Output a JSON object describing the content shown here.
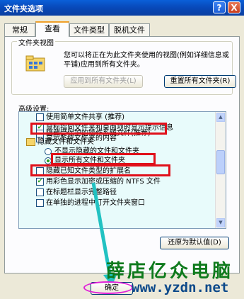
{
  "window": {
    "title": "文件夹选项",
    "help_label": "?",
    "close_label": "X"
  },
  "tabs": [
    {
      "label": "常规"
    },
    {
      "label": "查看"
    },
    {
      "label": "文件类型"
    },
    {
      "label": "脱机文件"
    }
  ],
  "folder_views": {
    "legend": "文件夹视图",
    "description": "您可以将正在为此文件夹使用的视图(例如详细信息或平铺)应用到所有文件夹。",
    "apply_all_label": "应用到所有文件夹(L)",
    "reset_all_label": "重置所有文件夹(R)"
  },
  "advanced": {
    "label": "高级设置:",
    "items": [
      {
        "type": "checkbox",
        "checked": false,
        "label": "使用简单文件共享 (推荐)"
      },
      {
        "type": "checkbox",
        "checked": true,
        "label": "鼠标指向文件夹和桌面项时显示提示信息"
      },
      {
        "type": "checkbox",
        "checked": false,
        "label": "显示系统文件夹的内容"
      },
      {
        "type": "checkbox",
        "checked": false,
        "label": "隐藏受保护的操作系统文件(推荐)"
      },
      {
        "type": "folder",
        "checked": false,
        "label": "隐藏文件和文件夹"
      },
      {
        "type": "radio",
        "checked": false,
        "label": "不显示隐藏的文件和文件夹"
      },
      {
        "type": "radio",
        "checked": true,
        "label": "显示所有文件和文件夹"
      },
      {
        "type": "checkbox",
        "checked": false,
        "label": "隐藏已知文件类型的扩展名"
      },
      {
        "type": "checkbox",
        "checked": true,
        "label": "用彩色显示加密或压缩的 NTFS 文件"
      },
      {
        "type": "checkbox",
        "checked": false,
        "label": "在标题栏显示完整路径"
      },
      {
        "type": "checkbox",
        "checked": false,
        "label": "在单独的进程中打开文件夹窗口"
      }
    ]
  },
  "restore_defaults_label": "还原为默认值(D)",
  "ok_label": "确定",
  "watermark": {
    "text": "薛店亿众电脑",
    "url": "www.yzdn.net"
  },
  "colors": {
    "highlight": "#e0101a",
    "ok_ellipse": "#e020d8",
    "arrow": "#22c2c2"
  }
}
